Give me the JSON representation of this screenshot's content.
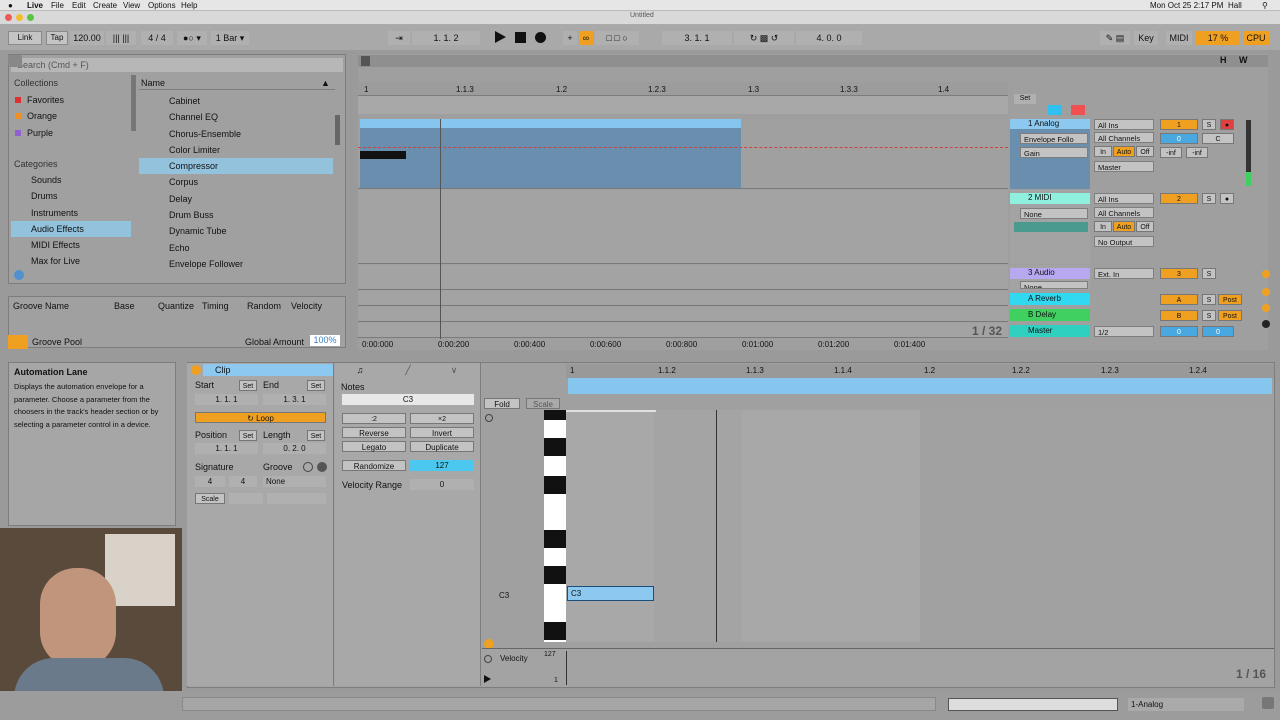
{
  "os": {
    "apple": "",
    "app": "Live",
    "menu": [
      "File",
      "Edit",
      "Create",
      "View",
      "Options",
      "Help"
    ],
    "title": "Untitled",
    "clock": "Mon Oct 25  2:17 PM",
    "user": "Hall"
  },
  "control": {
    "link": "Link",
    "tap": "Tap",
    "tempo": "120.00",
    "sig": "4 / 4",
    "quant": "1 Bar",
    "pos": "1.    1.    2",
    "loop_start": "3.    1.    1",
    "loop_len": "4.    0.    0",
    "key": "Key",
    "midi": "MIDI",
    "cpu_pct": "17 %",
    "cpu": "CPU"
  },
  "browser": {
    "search_placeholder": "Search (Cmd + F)",
    "collections_header": "Collections",
    "collections": [
      {
        "label": "Favorites",
        "color": "#e03030"
      },
      {
        "label": "Orange",
        "color": "#f09020"
      },
      {
        "label": "Purple",
        "color": "#9060d0"
      }
    ],
    "categories_header": "Categories",
    "categories": [
      "Sounds",
      "Drums",
      "Instruments",
      "Audio Effects",
      "MIDI Effects",
      "Max for Live"
    ],
    "name_header": "Name",
    "items": [
      "Cabinet",
      "Channel EQ",
      "Chorus-Ensemble",
      "Color Limiter",
      "Compressor",
      "Corpus",
      "Delay",
      "Drum Buss",
      "Dynamic Tube",
      "Echo",
      "Envelope Follower"
    ]
  },
  "groove": {
    "cols": [
      "Groove Name",
      "Base",
      "Quantize",
      "Timing",
      "Random",
      "Velocity"
    ],
    "pool": "Groove Pool",
    "global_label": "Global Amount",
    "global_value": "100%"
  },
  "arrangement": {
    "ticks": [
      "1",
      "1.1.3",
      "1.2",
      "1.2.3",
      "1.3",
      "1.3.3",
      "1.4"
    ],
    "times": [
      "0:00:000",
      "0:00:200",
      "0:00:400",
      "0:00:600",
      "0:00:800",
      "0:01:000",
      "0:01:200",
      "0:01:400"
    ],
    "zoom": "1 / 32",
    "set": "Set"
  },
  "tracks": [
    {
      "name": "1 Analog",
      "color": "#8cc8f0",
      "row1": "Envelope Follo",
      "row2": "Gain",
      "in1": "All Ins",
      "in2": "All Channels",
      "mon": [
        "In",
        "Auto",
        "Off"
      ],
      "out": "Master",
      "num": "1",
      "vol": "0",
      "pan": "C",
      "ch": "-inf",
      "ch2": "-inf"
    },
    {
      "name": "2 MIDI",
      "color": "#8ff0e0",
      "row1": "None",
      "in1": "All Ins",
      "in2": "All Channels",
      "mon": [
        "In",
        "Auto",
        "Off"
      ],
      "out": "No Output",
      "num": "2"
    },
    {
      "name": "3 Audio",
      "color": "#b8a8f0",
      "row1": "None",
      "in1": "Ext. In",
      "num": "3"
    },
    {
      "name": "A Reverb",
      "color": "#30d8f0",
      "num": "A",
      "post": "Post"
    },
    {
      "name": "B Delay",
      "color": "#40d060",
      "num": "B",
      "post": "Post"
    },
    {
      "name": "Master",
      "color": "#30d0c0",
      "in1": "1/2",
      "num": "0",
      "pan": "0"
    }
  ],
  "info": {
    "title": "Automation Lane",
    "body": "Displays the automation envelope for a parameter. Choose a parameter from the choosers in the track's header section or by selecting a parameter control in a device."
  },
  "clip": {
    "title": "Clip",
    "start": "Start",
    "end": "End",
    "set": "Set",
    "start_val": "1.    1.    1",
    "end_val": "1.    3.    1",
    "loop": "Loop",
    "position": "Position",
    "length": "Length",
    "pos_val": "1.    1.    1",
    "len_val": "0.    2.    0",
    "signature": "Signature",
    "groove": "Groove",
    "sig_num": "4",
    "sig_den": "4",
    "groove_val": "None",
    "scale": "Scale"
  },
  "notes": {
    "title": "Notes",
    "pitch": "C3",
    "half": ":2",
    "double": "×2",
    "reverse": "Reverse",
    "invert": "Invert",
    "legato": "Legato",
    "duplicate": "Duplicate",
    "randomize": "Randomize",
    "rand_val": "127",
    "vel_range": "Velocity Range",
    "vel_range_val": "0"
  },
  "editor": {
    "fold": "Fold",
    "scale": "Scale",
    "ticks": [
      "1",
      "1.1.2",
      "1.1.3",
      "1.1.4",
      "1.2",
      "1.2.2",
      "1.2.3",
      "1.2.4"
    ],
    "key_label": "C3",
    "note": "C3",
    "velocity": "Velocity",
    "vel_max": "127",
    "vel_min": "1",
    "zoom": "1 / 16"
  },
  "status": {
    "track": "1-Analog"
  }
}
